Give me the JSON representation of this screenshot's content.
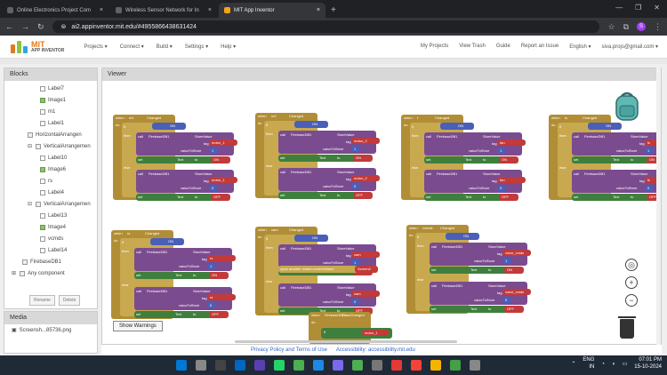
{
  "browser": {
    "tabs": [
      {
        "title": "Online Electronics Project Com",
        "active": false
      },
      {
        "title": "Wireless Sensor Network for In",
        "active": false
      },
      {
        "title": "MIT App Inventor",
        "active": true
      }
    ],
    "url": "ai2.appinventor.mit.edu/#4955866438631424",
    "profile_initial": "S"
  },
  "app": {
    "logo_line1": "MIT",
    "logo_line2": "APP INVENTOR",
    "menu": [
      "Projects ▾",
      "Connect ▾",
      "Build ▾",
      "Settings ▾",
      "Help ▾"
    ],
    "right_menu": [
      "My Projects",
      "View Trash",
      "Guide",
      "Report an Issue",
      "English ▾",
      "siva.projs@gmail.com ▾"
    ]
  },
  "blocks_panel": {
    "title": "Blocks",
    "items": [
      {
        "label": "Label7",
        "kind": "label",
        "indent": 1
      },
      {
        "label": "Image1",
        "kind": "image",
        "indent": 1
      },
      {
        "label": "m1",
        "kind": "label",
        "indent": 1
      },
      {
        "label": "Label1",
        "kind": "label",
        "indent": 1
      },
      {
        "label": "HorizontalArrangen",
        "kind": "box",
        "indent": 0
      },
      {
        "label": "VerticalArrangemen",
        "kind": "box",
        "indent": 0,
        "toggle": "⊟"
      },
      {
        "label": "Label10",
        "kind": "label",
        "indent": 1
      },
      {
        "label": "Image6",
        "kind": "image",
        "indent": 1
      },
      {
        "label": "rs",
        "kind": "label",
        "indent": 1
      },
      {
        "label": "Label4",
        "kind": "label",
        "indent": 1
      },
      {
        "label": "VerticalArrangemen",
        "kind": "box",
        "indent": 0,
        "toggle": "⊟"
      },
      {
        "label": "Label13",
        "kind": "label",
        "indent": 1
      },
      {
        "label": "Image4",
        "kind": "image",
        "indent": 1
      },
      {
        "label": "vcmds",
        "kind": "label",
        "indent": 1
      },
      {
        "label": "Label14",
        "kind": "label",
        "indent": 1
      },
      {
        "label": "FirebaseDB1",
        "kind": "box",
        "indent": -1
      },
      {
        "label": "Any component",
        "kind": "any",
        "indent": -2,
        "toggle": "⊞"
      }
    ],
    "rename_label": "Rename",
    "delete_label": "Delete"
  },
  "media_panel": {
    "title": "Media",
    "items": [
      "Screensh...85736.png"
    ]
  },
  "viewer": {
    "title": "Viewer",
    "warning_count": "0",
    "error_count": "0",
    "show_warnings_label": "Show Warnings",
    "event_blocks": [
      {
        "component": "m1",
        "event": "Changed",
        "param": "tag",
        "text": "motor_1"
      },
      {
        "component": "m2",
        "event": "Changed",
        "param": "tag",
        "text": "motor_2"
      },
      {
        "component": "f",
        "event": "Changed",
        "param": "tag",
        "text": "fan"
      },
      {
        "component": "ls",
        "event": "Changed",
        "param": "tag",
        "text": "ls"
      },
      {
        "component": "rs",
        "event": "Changed",
        "param": "tag",
        "text": "rs"
      },
      {
        "component": "cam",
        "event": "Changed",
        "param": "tag",
        "text": "cam"
      },
      {
        "component": "vcmds",
        "event": "Changed",
        "param": "tag",
        "text": "voice_cmds"
      },
      {
        "component": "FirebaseDB1",
        "event": "DataChanged",
        "param": "tag",
        "text": "motor_1"
      }
    ],
    "block_words": {
      "when": "when",
      "do": "do",
      "if": "if",
      "then": "then",
      "else": "else",
      "call": "call",
      "set": "set",
      "to": "to",
      "tag": "tag",
      "value_to_store": "valueToStore",
      "store_value": "StoreValue",
      "firebase": "FirebaseDB1",
      "on": "ON",
      "off": "OFF",
      "on_val": "1",
      "off_val": "0",
      "open_screen": "open another screen screenName",
      "screen": "Screen2",
      "text_prop": "Text"
    }
  },
  "footer": {
    "privacy": "Privacy Policy and Terms of Use",
    "accessibility": "Accessibility: accessibility.mit.edu"
  },
  "taskbar": {
    "lang_line1": "ENG",
    "lang_line2": "IN",
    "time": "07:01 PM",
    "date": "15-10-2024"
  },
  "colors": {
    "event": "#b18e35",
    "control": "#c8a94f",
    "procedure": "#7b4b8f",
    "setter": "#3f7f3d",
    "text": "#c23a3a",
    "logic": "#4a5fb8"
  }
}
